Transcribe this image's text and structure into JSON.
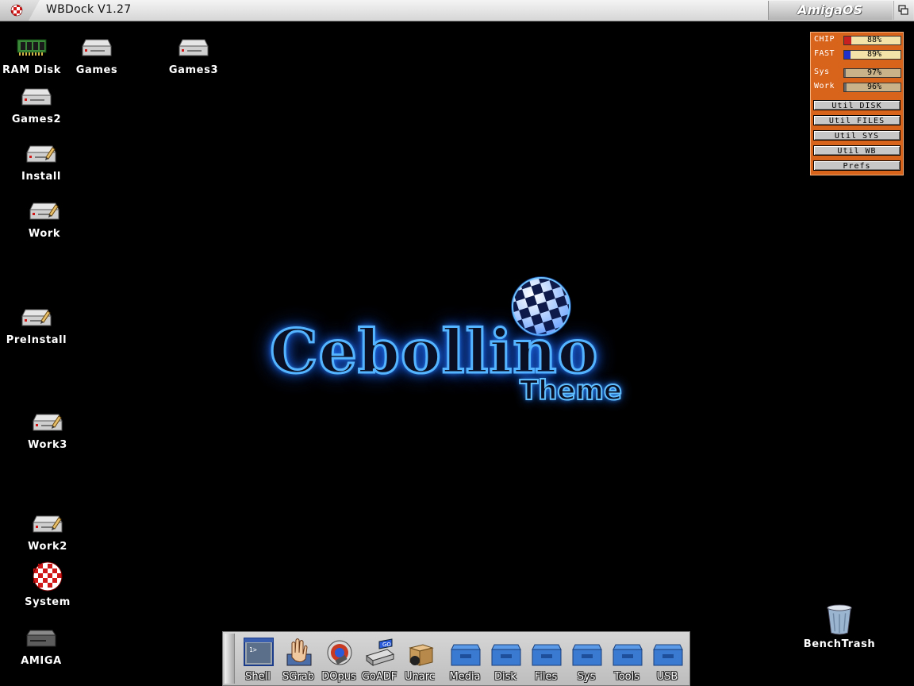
{
  "titlebar": {
    "title": "WBDock V1.27",
    "brand": "AmigaOS"
  },
  "desktop_icons": [
    {
      "label": "RAM Disk",
      "icon": "ram-chip-icon"
    },
    {
      "label": "Games",
      "icon": "hard-drive-icon"
    },
    {
      "label": "Games3",
      "icon": "hard-drive-icon"
    },
    {
      "label": "Games2",
      "icon": "hard-drive-icon"
    },
    {
      "label": "Install",
      "icon": "drive-with-pencil-icon"
    },
    {
      "label": "Work",
      "icon": "drive-with-pencil-icon"
    },
    {
      "label": "PreInstall",
      "icon": "drive-with-pencil-icon"
    },
    {
      "label": "Work3",
      "icon": "drive-with-pencil-icon"
    },
    {
      "label": "Work2",
      "icon": "drive-with-pencil-icon"
    },
    {
      "label": "System",
      "icon": "boing-ball-icon"
    },
    {
      "label": "AMIGA",
      "icon": "amiga-drive-icon"
    },
    {
      "label": "BenchTrash",
      "icon": "trash-can-icon"
    }
  ],
  "logo": {
    "word": "Cebollino",
    "sub": "Theme"
  },
  "meters": [
    {
      "label": "CHIP",
      "value": "88%",
      "level": 0.12,
      "bg": "#f4e3a8",
      "fill": "#c82020"
    },
    {
      "label": "FAST",
      "value": "89%",
      "level": 0.11,
      "bg": "#f4e3a8",
      "fill": "#2030c8"
    },
    {
      "label": "Sys",
      "value": "97%",
      "level": 0.03,
      "bg": "#c9b28a",
      "fill": "#666666"
    },
    {
      "label": "Work",
      "value": "96%",
      "level": 0.04,
      "bg": "#c9b28a",
      "fill": "#666666"
    }
  ],
  "util_buttons": [
    "Util DISK",
    "Util FILES",
    "Util SYS",
    "Util WB",
    "Prefs"
  ],
  "dock_items": [
    {
      "label": "Shell",
      "icon": "shell-window-icon"
    },
    {
      "label": "SGrab",
      "icon": "grab-hand-icon"
    },
    {
      "label": "DOpus",
      "icon": "dopus-icon"
    },
    {
      "label": "GoADF",
      "icon": "goadf-icon"
    },
    {
      "label": "Unarc",
      "icon": "box-icon"
    },
    {
      "label": "Media",
      "icon": "drawer-icon"
    },
    {
      "label": "Disk",
      "icon": "drawer-icon"
    },
    {
      "label": "Files",
      "icon": "drawer-icon"
    },
    {
      "label": "Sys",
      "icon": "drawer-icon"
    },
    {
      "label": "Tools",
      "icon": "drawer-icon"
    },
    {
      "label": "USB",
      "icon": "drawer-icon"
    }
  ],
  "colors": {
    "accent": "#d8641c",
    "glow": "#2a8cff"
  }
}
